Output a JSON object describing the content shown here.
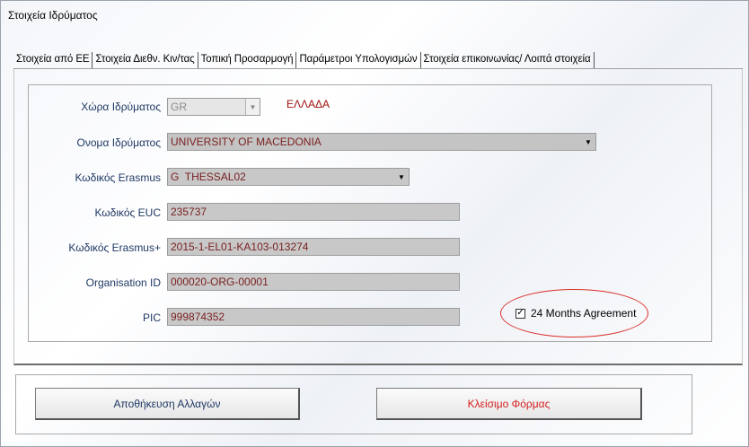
{
  "window": {
    "title": "Στοιχεία Ιδρύματος"
  },
  "tabs": [
    {
      "label": "Στοιχεία από ΕΕ"
    },
    {
      "label": "Στοιχεία Διεθν. Κιν/τας"
    },
    {
      "label": "Τοπική Προσαρμογή"
    },
    {
      "label": "Παράμετροι Υπολογισμών"
    },
    {
      "label": "Στοιχεία επικοινωνίας/ Λοιπά στοιχεία"
    }
  ],
  "form": {
    "country": {
      "label": "Χώρα Ιδρύματος",
      "value": "GR",
      "name_text": "ΕΛΛΑΔΑ"
    },
    "institution_name": {
      "label": "Ονομα Ιδρύματος",
      "value": "UNIVERSITY OF MACEDONIA"
    },
    "erasmus_code": {
      "label": "Κωδικός Erasmus",
      "value": "G  THESSAL02"
    },
    "euc_code": {
      "label": "Κωδικός EUC",
      "value": "235737"
    },
    "erasmus_plus_code": {
      "label": "Κωδικός Erasmus+",
      "value": "2015-1-EL01-KA103-013274"
    },
    "organisation_id": {
      "label": "Organisation ID",
      "value": "000020-ORG-00001"
    },
    "pic": {
      "label": "PIC",
      "value": "999874352"
    },
    "months_agreement": {
      "label": "24 Months Agreement",
      "checked": true,
      "check_glyph": "✓"
    }
  },
  "buttons": {
    "save": "Αποθήκευση Αλλαγών",
    "close": "Κλείσιμο Φόρμας"
  },
  "colors": {
    "field_value": "#7a2020",
    "country_name": "#a01010",
    "label": "#1f3864",
    "close_button_text": "#d42020",
    "highlight_ellipse": "#d9302a"
  }
}
